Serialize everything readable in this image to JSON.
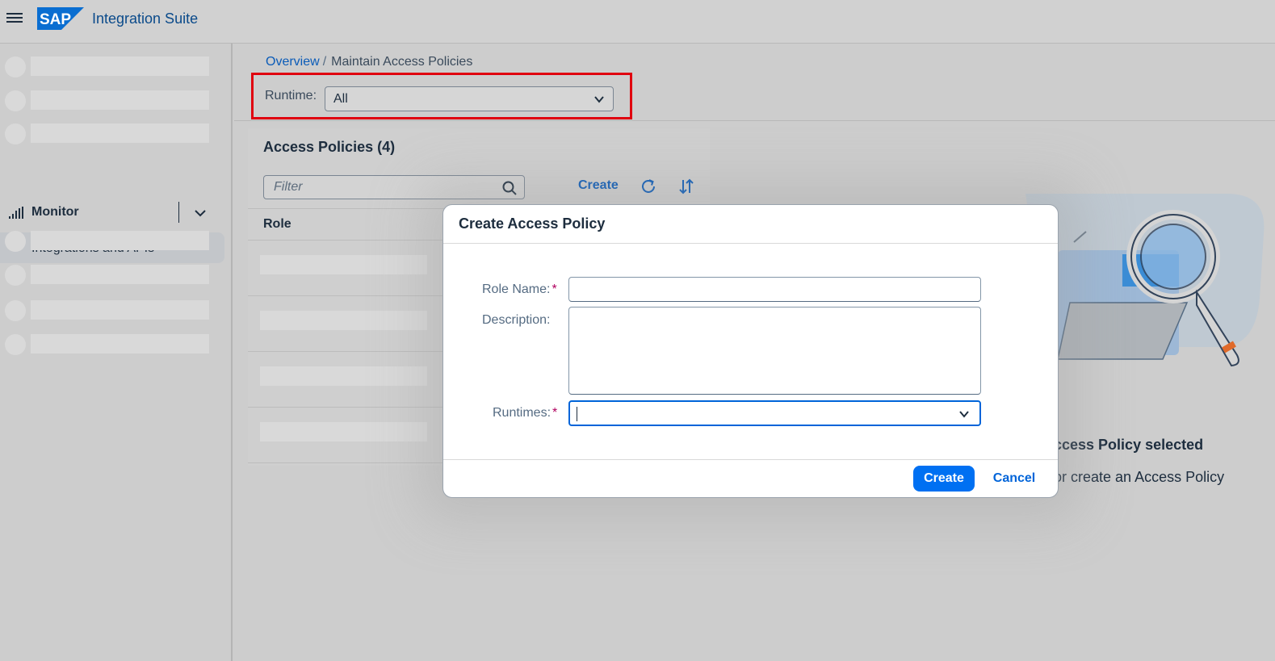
{
  "shell": {
    "product_name": "Integration Suite",
    "logo_text": "SAP"
  },
  "sidenav": {
    "monitor_label": "Monitor",
    "sub_item_label": "Integrations and APIs"
  },
  "breadcrumb": {
    "overview": "Overview",
    "separator": "/",
    "current": "Maintain Access Policies"
  },
  "runtime_filter": {
    "label": "Runtime:",
    "value": "All"
  },
  "list": {
    "title": "Access Policies (4)",
    "filter_placeholder": "Filter",
    "create_label": "Create",
    "column_role": "Role",
    "row_count": 4
  },
  "empty_state": {
    "title": "ccess Policy selected",
    "subtitle": "or create an Access Policy"
  },
  "dialog": {
    "title": "Create Access Policy",
    "role_name_label": "Role Name:",
    "description_label": "Description:",
    "runtimes_label": "Runtimes:",
    "required_marker": "*",
    "role_name_value": "",
    "description_value": "",
    "runtimes_value": "",
    "create_button": "Create",
    "cancel_button": "Cancel"
  },
  "colors": {
    "brand_blue": "#0070f2",
    "link_blue": "#0a5bb8",
    "highlight_red": "#e0000f",
    "required_magenta": "#b0005e"
  }
}
